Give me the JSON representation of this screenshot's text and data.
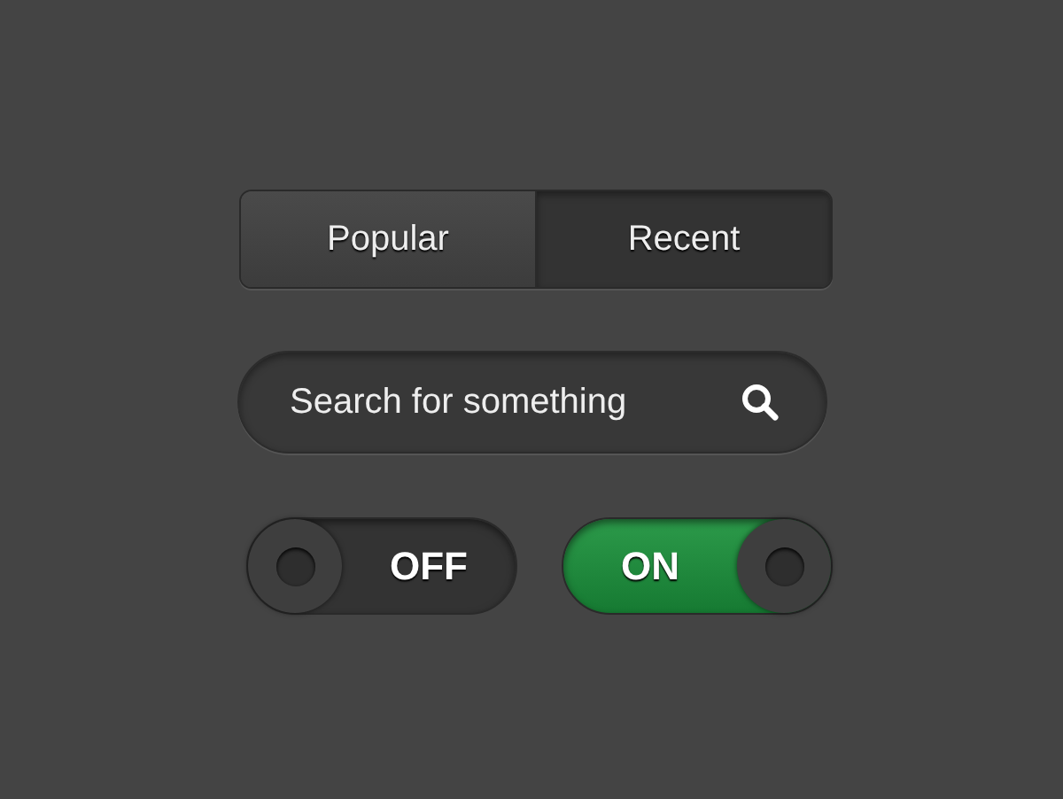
{
  "tabs": [
    {
      "label": "Popular",
      "selected": false
    },
    {
      "label": "Recent",
      "selected": true
    }
  ],
  "search": {
    "placeholder": "Search for something"
  },
  "toggles": [
    {
      "label": "OFF",
      "on": false
    },
    {
      "label": "ON",
      "on": true
    }
  ]
}
